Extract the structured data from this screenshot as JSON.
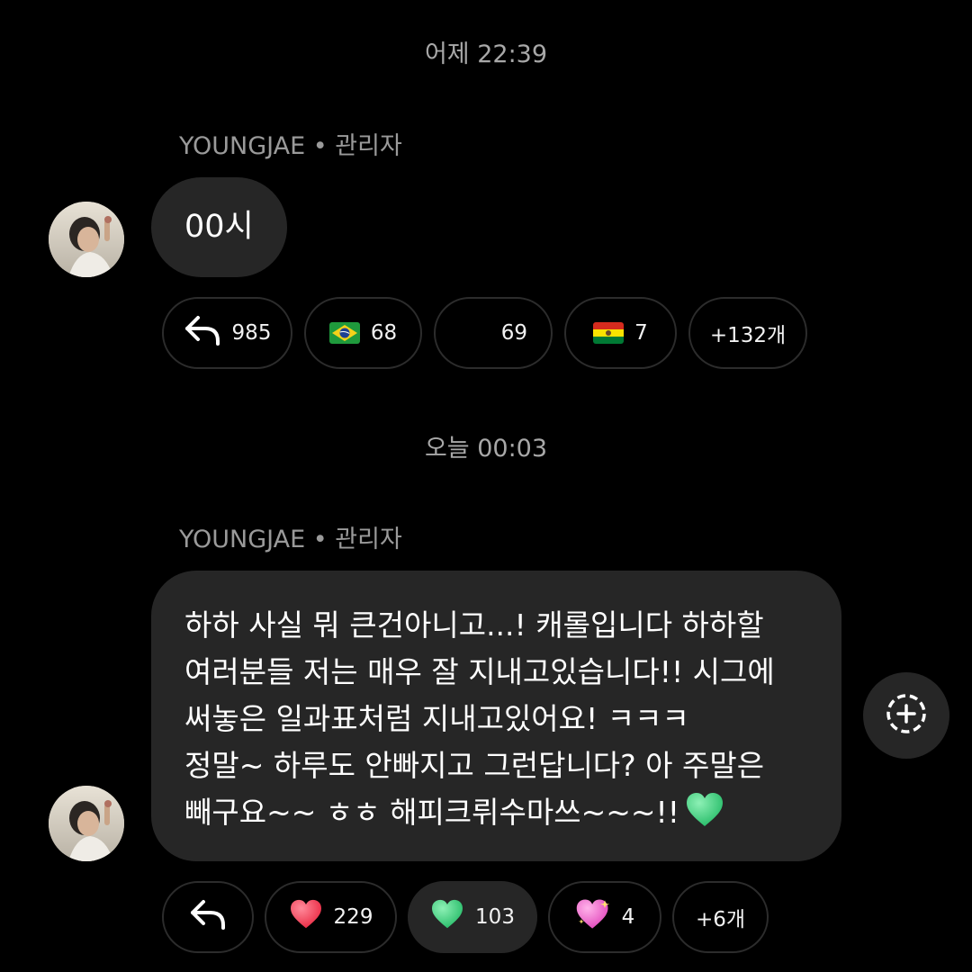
{
  "timestamps": {
    "first": "어제 22:39",
    "second": "오늘 00:03"
  },
  "messages": [
    {
      "sender": "YOUNGJAE • 관리자",
      "text": "00시",
      "reactions": {
        "reply_count": "985",
        "items": [
          {
            "icon": "brazil-flag",
            "count": "68"
          },
          {
            "icon": "blank-emoji",
            "count": "69"
          },
          {
            "icon": "bolivia-flag",
            "count": "7"
          }
        ],
        "more": "+132개"
      }
    },
    {
      "sender": "YOUNGJAE • 관리자",
      "text": "하하 사실 뭐 큰건아니고...! 캐롤입니다 하하할\n여러분들 저는 매우 잘 지내고있습니다!! 시그에\n써놓은 일과표처럼 지내고있어요! ㅋㅋㅋ\n정말~ 하루도 안빠지고 그런답니다? 아 주말은\n빼구요~~ ㅎㅎ 해피크뤼수마쓰~~~!!",
      "trailing_icon": "green-heart",
      "reactions": {
        "items": [
          {
            "icon": "red-heart",
            "count": "229"
          },
          {
            "icon": "green-heart",
            "count": "103",
            "selected": true
          },
          {
            "icon": "sparkling-heart",
            "count": "4"
          }
        ],
        "more": "+6개"
      }
    }
  ],
  "colors": {
    "background": "#000000",
    "bubble": "#262626",
    "muted_text": "#a8a8a8",
    "pill_border": "#2c2c2c"
  }
}
